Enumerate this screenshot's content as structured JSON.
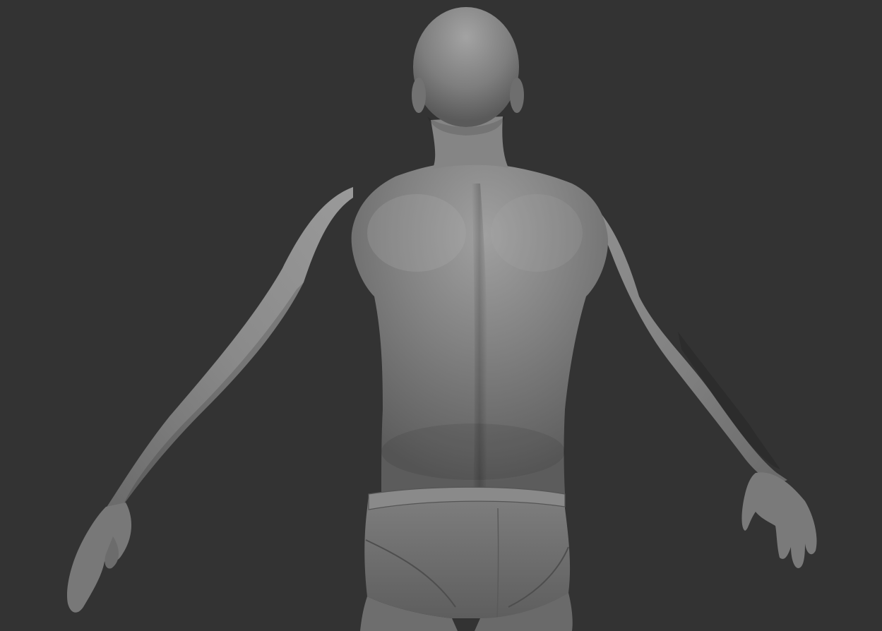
{
  "scene": {
    "background_color": "#333333",
    "model_base_color": "#7a7a7a",
    "model_highlight_color": "#a6a6a6",
    "model_shadow_color": "#4a4a4a",
    "subject": "back-view-male-sculpt"
  }
}
